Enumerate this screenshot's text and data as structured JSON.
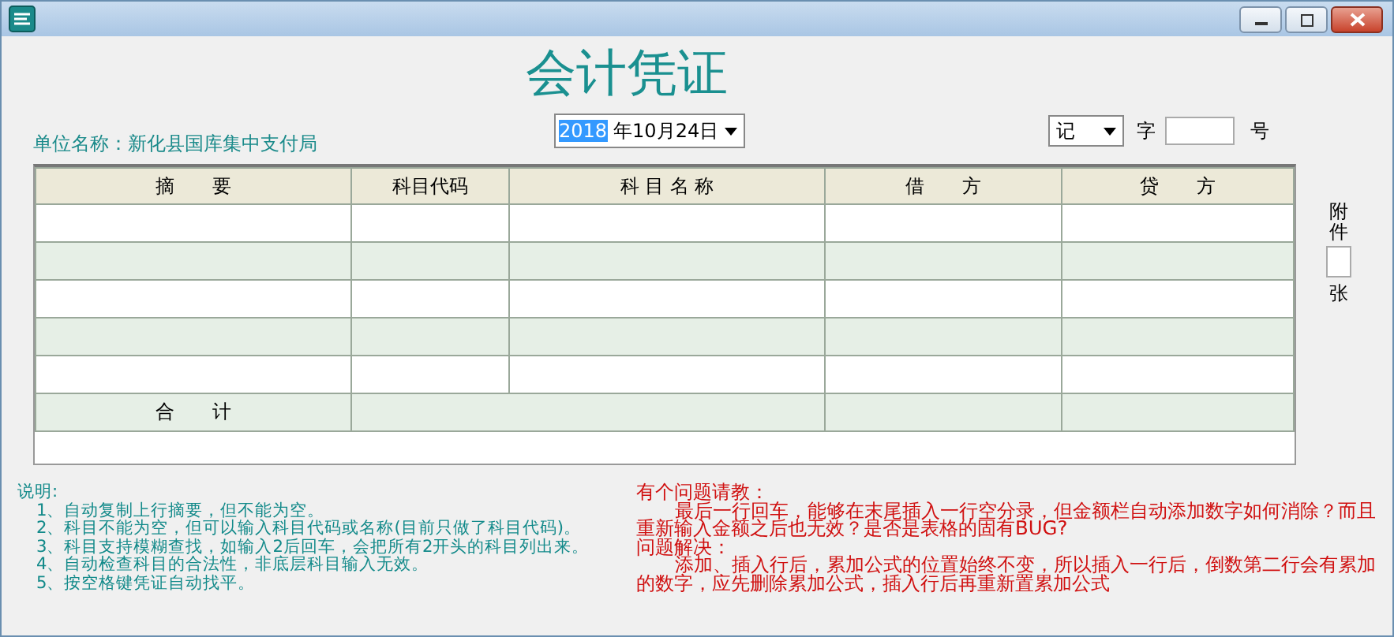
{
  "window": {
    "title": "会计凭证"
  },
  "unit": {
    "label": "单位名称：新化县国库集中支付局"
  },
  "date_field": {
    "selected_part": "2018",
    "rest": "年10月24日"
  },
  "voucher": {
    "type_value": "记",
    "type_label": "字",
    "number_label": "号"
  },
  "table": {
    "columns": [
      "摘　　要",
      "科目代码",
      "科 目 名 称",
      "借　　方",
      "贷　　方"
    ],
    "rows": [
      {
        "shaded": false
      },
      {
        "shaded": true
      },
      {
        "shaded": false
      },
      {
        "shaded": true
      },
      {
        "shaded": false
      }
    ],
    "total_label": "合　　计"
  },
  "attachments": {
    "label_top": "附件",
    "label_bottom": "张"
  },
  "notes": {
    "title": "说明:",
    "lines": [
      "1、自动复制上行摘要，但不能为空。",
      "2、科目不能为空，但可以输入科目代码或名称(目前只做了科目代码)。",
      "3、科目支持模糊查找，如输入2后回车，会把所有2开头的科目列出来。",
      "4、自动检查科目的合法性，非底层科目输入无效。",
      "5、按空格键凭证自动找平。"
    ]
  },
  "question": {
    "title": "有个问题请教：",
    "body": "最后一行回车，能够在末尾插入一行空分录，但金额栏自动添加数字如何消除？而且重新输入金额之后也无效？是否是表格的固有BUG?",
    "answer_title": "问题解决：",
    "answer": "添加、插入行后，累加公式的位置始终不变，所以插入一行后，倒数第二行会有累加的数字，应先删除累加公式，插入行后再重新置累加公式"
  }
}
